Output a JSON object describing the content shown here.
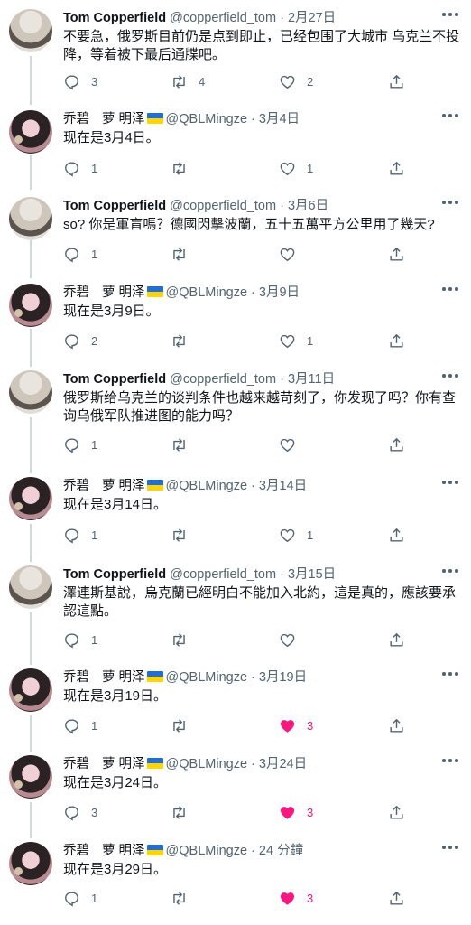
{
  "colors": {
    "like_active": "#f91880",
    "muted": "#536471",
    "text": "#0f1419",
    "thread_line": "#cfd9de"
  },
  "icons": {
    "reply": "reply-icon",
    "retweet": "retweet-icon",
    "like": "heart-icon",
    "share": "share-icon",
    "more": "more-icon"
  },
  "tweets": [
    {
      "name": "Tom Copperfield",
      "handle": "@copperfield_tom",
      "dot": "·",
      "time": "2月27日",
      "text": "不要急，俄罗斯目前仍是点到即止，已经包围了大城市 乌克兰不投降，等着被下最后通牒吧。",
      "reply": "3",
      "retweet": "4",
      "like": "2"
    },
    {
      "name_a": "乔碧",
      "name_b": "萝 明泽",
      "handle": "@QBLMingze",
      "dot": "·",
      "time": "3月4日",
      "text": "现在是3月4日。",
      "reply": "1",
      "retweet": "",
      "like": "1"
    },
    {
      "name": "Tom Copperfield",
      "handle": "@copperfield_tom",
      "dot": "·",
      "time": "3月6日",
      "text": "so? 你是軍盲嗎？德國閃擊波蘭，五十五萬平方公里用了幾天?",
      "reply": "1",
      "retweet": "",
      "like": ""
    },
    {
      "name_a": "乔碧",
      "name_b": "萝 明泽",
      "handle": "@QBLMingze",
      "dot": "·",
      "time": "3月9日",
      "text": "现在是3月9日。",
      "reply": "2",
      "retweet": "",
      "like": "1"
    },
    {
      "name": "Tom Copperfield",
      "handle": "@copperfield_tom",
      "dot": "·",
      "time": "3月11日",
      "text": "俄罗斯给乌克兰的谈判条件也越来越苛刻了，你发现了吗？你有查询乌俄军队推进图的能力吗？",
      "reply": "1",
      "retweet": "",
      "like": ""
    },
    {
      "name_a": "乔碧",
      "name_b": "萝 明泽",
      "handle": "@QBLMingze",
      "dot": "·",
      "time": "3月14日",
      "text": "现在是3月14日。",
      "reply": "1",
      "retweet": "",
      "like": "1"
    },
    {
      "name": "Tom Copperfield",
      "handle": "@copperfield_tom",
      "dot": "·",
      "time": "3月15日",
      "text": "澤連斯基說，烏克蘭已經明白不能加入北約，這是真的，應該要承認這點。",
      "reply": "1",
      "retweet": "",
      "like": ""
    },
    {
      "name_a": "乔碧",
      "name_b": "萝 明泽",
      "handle": "@QBLMingze",
      "dot": "·",
      "time": "3月19日",
      "text": "现在是3月19日。",
      "reply": "1",
      "retweet": "",
      "like": "3",
      "liked": true
    },
    {
      "name_a": "乔碧",
      "name_b": "萝 明泽",
      "handle": "@QBLMingze",
      "dot": "·",
      "time": "3月24日",
      "text": "现在是3月24日。",
      "reply": "3",
      "retweet": "",
      "like": "3",
      "liked": true
    },
    {
      "name_a": "乔碧",
      "name_b": "萝 明泽",
      "handle": "@QBLMingze",
      "dot": "·",
      "time": "24 分鐘",
      "text": "现在是3月29日。",
      "reply": "1",
      "retweet": "",
      "like": "3",
      "liked": true
    }
  ]
}
